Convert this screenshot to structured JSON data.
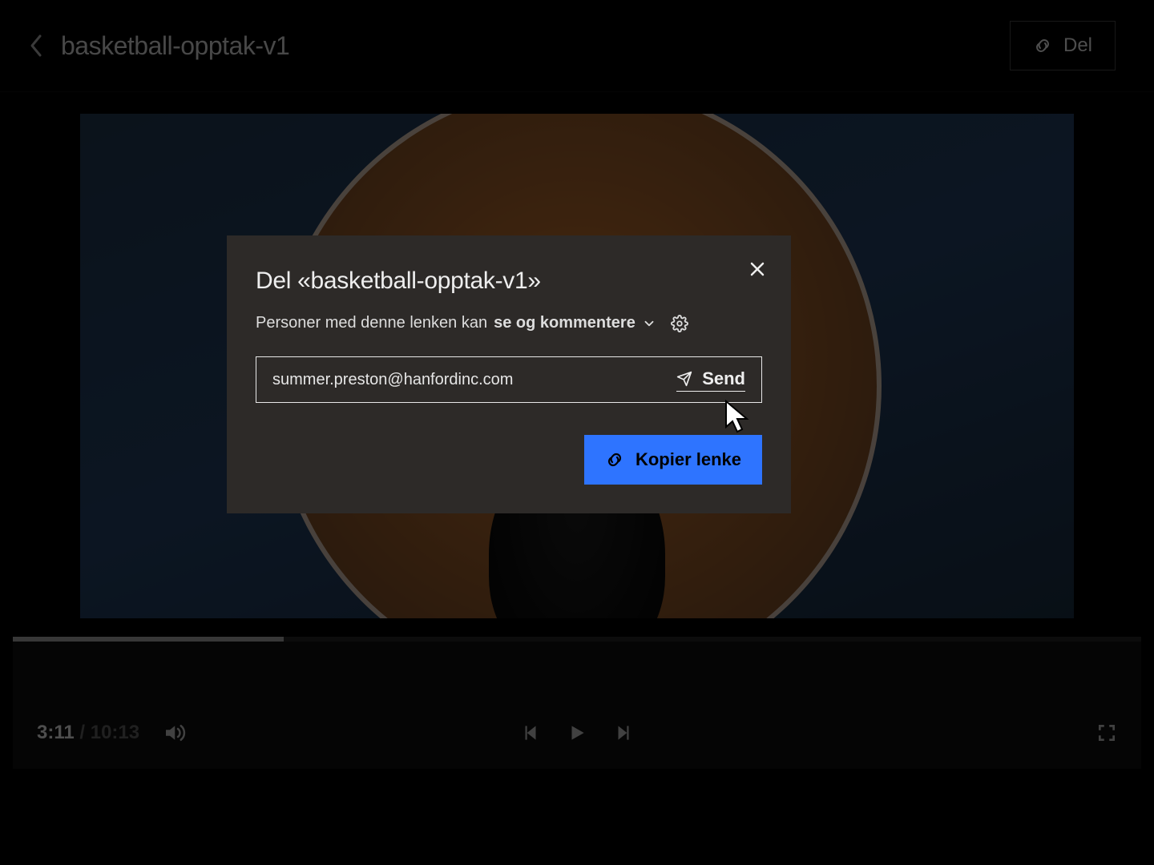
{
  "header": {
    "title": "basketball-opptak-v1",
    "share_label": "Del"
  },
  "player": {
    "current_time": "3:11",
    "separator": " / ",
    "duration": "10:13",
    "progress_percent": 24
  },
  "modal": {
    "title": "Del «basketball-opptak-v1»",
    "perm_prefix": "Personer med denne lenken kan",
    "perm_mode": "se og kommentere",
    "email_value": "summer.preston@hanfordinc.com",
    "send_label": "Send",
    "copy_label": "Kopier lenke"
  }
}
